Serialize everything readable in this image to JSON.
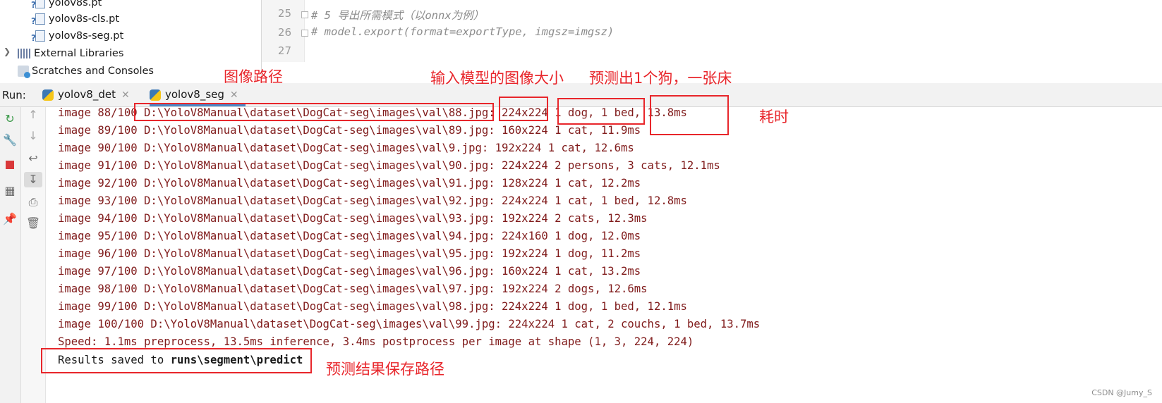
{
  "project_tree": {
    "items": [
      {
        "label": "yolov8s.pt",
        "icon": "python-file-icon"
      },
      {
        "label": "yolov8s-cls.pt",
        "icon": "python-file-icon"
      },
      {
        "label": "yolov8s-seg.pt",
        "icon": "python-file-icon"
      },
      {
        "label": "External Libraries",
        "icon": "library-icon"
      },
      {
        "label": "Scratches and Consoles",
        "icon": "scratch-icon"
      }
    ]
  },
  "editor": {
    "lines": [
      {
        "number": "25",
        "code": "# 5 导出所需模式（以onnx为例）"
      },
      {
        "number": "26",
        "code": "# model.export(format=exportType, imgsz=imgsz)"
      },
      {
        "number": "27",
        "code": ""
      }
    ]
  },
  "run_bar": {
    "label": "Run:",
    "tabs": [
      {
        "label": "yolov8_det",
        "active": false
      },
      {
        "label": "yolov8_seg",
        "active": true
      }
    ]
  },
  "console": {
    "lines": [
      "image 88/100 D:\\YoloV8Manual\\dataset\\DogCat-seg\\images\\val\\88.jpg: 224x224 1 dog, 1 bed, 13.8ms",
      "image 89/100 D:\\YoloV8Manual\\dataset\\DogCat-seg\\images\\val\\89.jpg: 160x224 1 cat, 11.9ms",
      "image 90/100 D:\\YoloV8Manual\\dataset\\DogCat-seg\\images\\val\\9.jpg: 192x224 1 cat, 12.6ms",
      "image 91/100 D:\\YoloV8Manual\\dataset\\DogCat-seg\\images\\val\\90.jpg: 224x224 2 persons, 3 cats, 12.1ms",
      "image 92/100 D:\\YoloV8Manual\\dataset\\DogCat-seg\\images\\val\\91.jpg: 128x224 1 cat, 12.2ms",
      "image 93/100 D:\\YoloV8Manual\\dataset\\DogCat-seg\\images\\val\\92.jpg: 224x224 1 cat, 1 bed, 12.8ms",
      "image 94/100 D:\\YoloV8Manual\\dataset\\DogCat-seg\\images\\val\\93.jpg: 192x224 2 cats, 12.3ms",
      "image 95/100 D:\\YoloV8Manual\\dataset\\DogCat-seg\\images\\val\\94.jpg: 224x160 1 dog, 12.0ms",
      "image 96/100 D:\\YoloV8Manual\\dataset\\DogCat-seg\\images\\val\\95.jpg: 192x224 1 dog, 11.2ms",
      "image 97/100 D:\\YoloV8Manual\\dataset\\DogCat-seg\\images\\val\\96.jpg: 160x224 1 cat, 13.2ms",
      "image 98/100 D:\\YoloV8Manual\\dataset\\DogCat-seg\\images\\val\\97.jpg: 192x224 2 dogs, 12.6ms",
      "image 99/100 D:\\YoloV8Manual\\dataset\\DogCat-seg\\images\\val\\98.jpg: 224x224 1 dog, 1 bed, 12.1ms",
      "image 100/100 D:\\YoloV8Manual\\dataset\\DogCat-seg\\images\\val\\99.jpg: 224x224 1 cat, 2 couchs, 1 bed, 13.7ms",
      "Speed: 1.1ms preprocess, 13.5ms inference, 3.4ms postprocess per image at shape (1, 3, 224, 224)"
    ],
    "results_prefix": "Results saved to ",
    "results_path": "runs\\segment\\predict"
  },
  "annotations": {
    "image_path": "图像路径",
    "input_size": "输入模型的图像大小",
    "detected": "预测出1个狗，一张床",
    "time_cost": "耗时",
    "result_path": "预测结果保存路径"
  },
  "watermark": "CSDN @Jumy_S",
  "colors": {
    "annotation_red": "#e8262b",
    "console_text": "#801b1b",
    "tab_accent": "#4a88c7"
  }
}
